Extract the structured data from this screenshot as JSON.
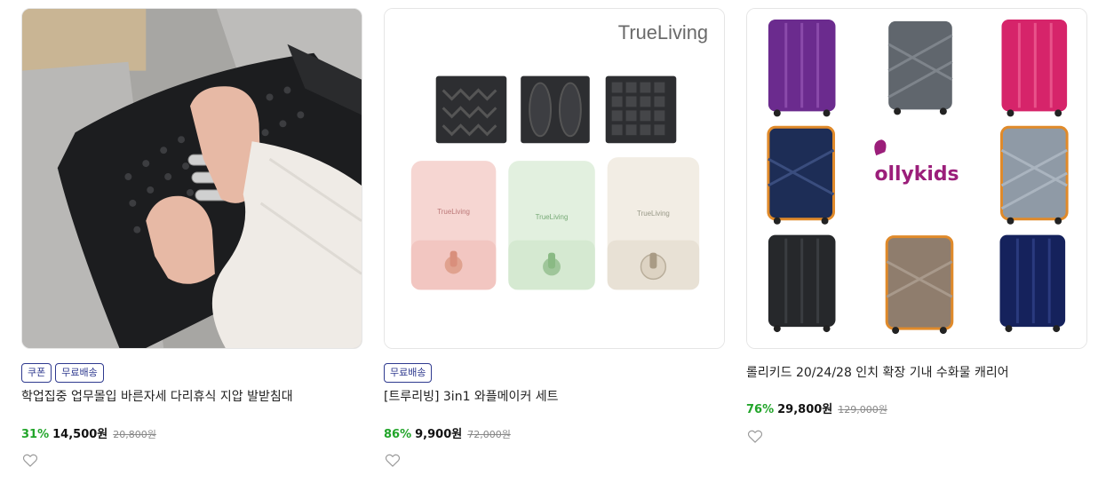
{
  "products": [
    {
      "badges": [
        "쿠폰",
        "무료배송"
      ],
      "title": "학업집중 업무몰입 바른자세 다리휴식 지압 발받침대",
      "discount": "31%",
      "price": "14,500원",
      "original_price": "20,800원",
      "image_subject": "footrest"
    },
    {
      "badges": [
        "무료배송"
      ],
      "title": "[트루리빙] 3in1 와플메이커 세트",
      "discount": "86%",
      "price": "9,900원",
      "original_price": "72,000원",
      "image_subject": "waffle-maker",
      "brand_logo_text": "TrueLiving",
      "device_label": "TrueLiving"
    },
    {
      "badges": [],
      "title": "롤리키드 20/24/28 인치 확장 기내 수화물 캐리어",
      "discount": "76%",
      "price": "29,800원",
      "original_price": "129,000원",
      "image_subject": "suitcases",
      "brand_logo_text": "ollykids"
    }
  ],
  "colors": {
    "badge": "#2f3a8f",
    "discount": "#22a52a",
    "border": "#e5e5e5"
  },
  "icons": {
    "wishlist": "heart-outline-icon"
  }
}
